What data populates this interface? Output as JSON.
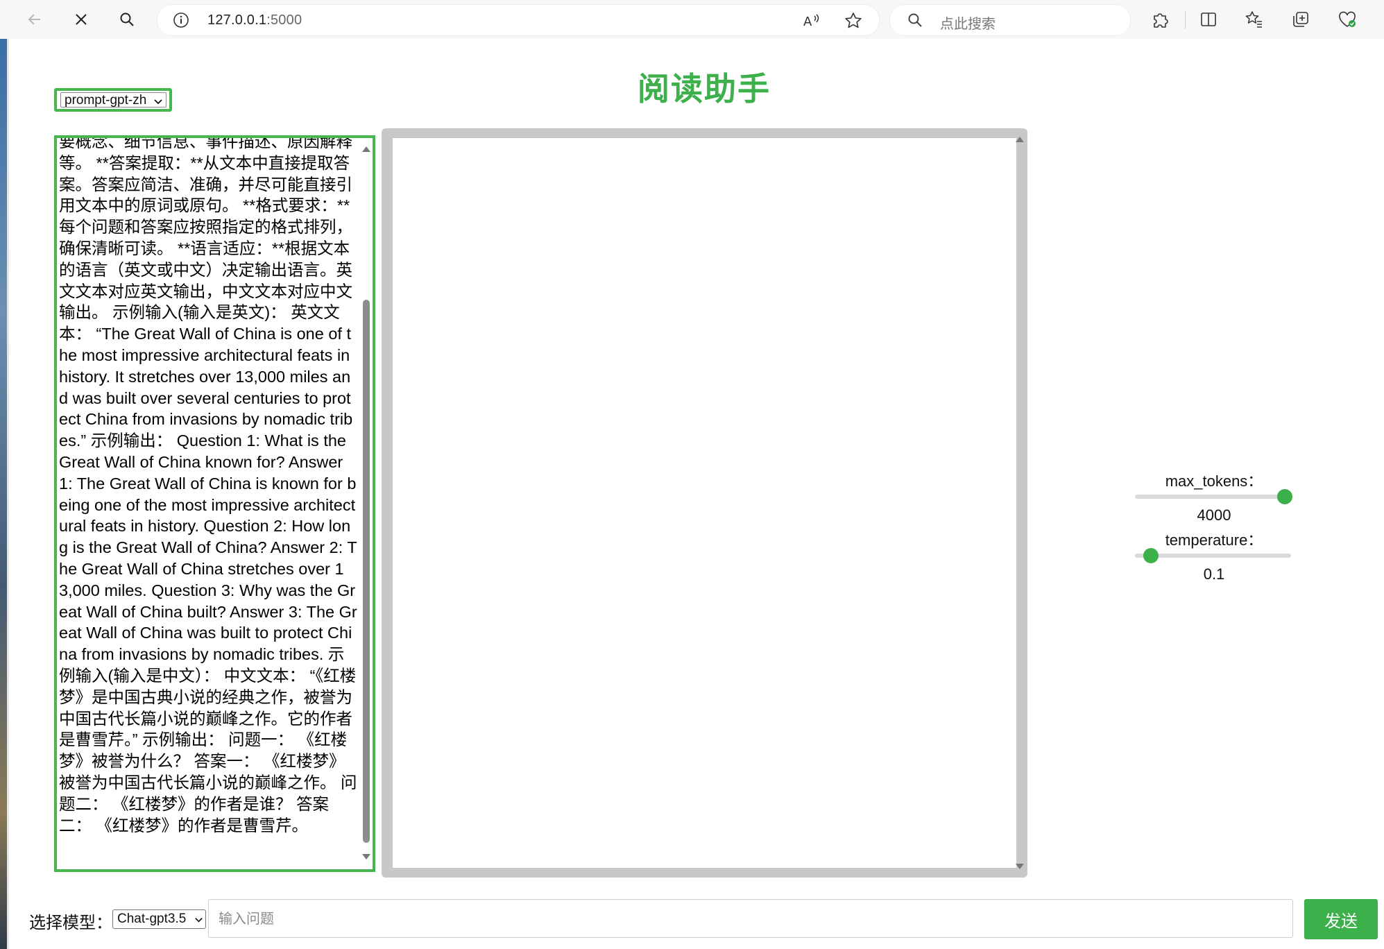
{
  "browser": {
    "url_host": "127.0.0.1",
    "url_port": ":5000",
    "search_placeholder": "点此搜索"
  },
  "page": {
    "title": "阅读助手"
  },
  "prompt_select": {
    "selected": "prompt-gpt-zh"
  },
  "prompt_text": "要概念、细节信息、事件描述、原因解释等。 **答案提取：**从文本中直接提取答案。答案应简洁、准确，并尽可能直接引用文本中的原词或原句。 **格式要求：**每个问题和答案应按照指定的格式排列，确保清晰可读。 **语言适应：**根据文本的语言（英文或中文）决定输出语言。英文文本对应英文输出，中文文本对应中文输出。 示例输入(输入是英文)： 英文文本： “The Great Wall of China is one of the most impressive architectural feats in history. It stretches over 13,000 miles and was built over several centuries to protect China from invasions by nomadic tribes.” 示例输出： Question 1: What is the Great Wall of China known for? Answer 1: The Great Wall of China is known for being one of the most impressive architectural feats in history. Question 2: How long is the Great Wall of China? Answer 2: The Great Wall of China stretches over 13,000 miles. Question 3: Why was the Great Wall of China built? Answer 3: The Great Wall of China was built to protect China from invasions by nomadic tribes. 示例输入(输入是中文）： 中文文本： “《红楼梦》是中国古典小说的经典之作，被誉为中国古代长篇小说的巅峰之作。它的作者是曹雪芹。” 示例输出： 问题一： 《红楼梦》被誉为什么？ 答案一： 《红楼梦》被誉为中国古代长篇小说的巅峰之作。 问题二： 《红楼梦》的作者是谁？ 答案二： 《红楼梦》的作者是曹雪芹。",
  "params": {
    "max_tokens": {
      "label": "max_tokens：",
      "value": "4000",
      "fraction": 0.96
    },
    "temperature": {
      "label": "temperature：",
      "value": "0.1",
      "fraction": 0.1
    }
  },
  "bottom": {
    "model_label": "选择模型：",
    "model_selected": "Chat-gpt3.5",
    "question_placeholder": "输入问题",
    "send_label": "发送"
  },
  "colors": {
    "accent": "#3cb04b",
    "output_frame": "#c8c8c8"
  },
  "icons": {
    "back": "arrow-left-icon",
    "stop": "close-icon",
    "search": "search-icon",
    "info": "info-icon",
    "read_aloud": "read-aloud-icon",
    "favorite": "star-icon",
    "extensions": "puzzle-icon",
    "split": "split-screen-icon",
    "favorites": "favorites-icon",
    "collections": "collections-icon",
    "health": "browser-essentials-icon"
  }
}
